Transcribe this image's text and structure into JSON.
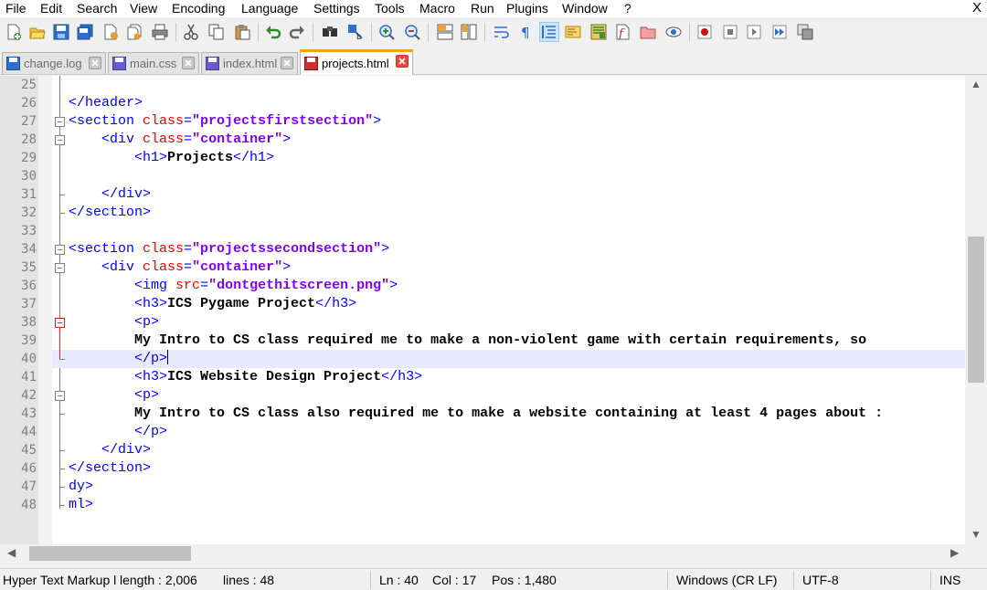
{
  "menu": {
    "items": [
      "File",
      "Edit",
      "Search",
      "View",
      "Encoding",
      "Language",
      "Settings",
      "Tools",
      "Macro",
      "Run",
      "Plugins",
      "Window",
      "?"
    ],
    "close": "X"
  },
  "toolbar": {
    "icons": [
      "new-file-icon",
      "open-file-icon",
      "save-icon",
      "save-all-icon",
      "close-icon",
      "close-all-icon",
      "print-icon",
      "cut-icon",
      "copy-icon",
      "paste-icon",
      "undo-icon",
      "redo-icon",
      "find-icon",
      "replace-icon",
      "zoom-in-icon",
      "zoom-out-icon",
      "sync-vertical-icon",
      "sync-horizontal-icon",
      "word-wrap-icon",
      "show-all-chars-icon",
      "indent-guide-icon",
      "udl-icon",
      "doc-map-icon",
      "function-list-icon",
      "folder-as-workspace-icon",
      "monitoring-icon",
      "record-macro-icon",
      "stop-macro-icon",
      "play-macro-icon",
      "run-macro-multiple-icon",
      "save-macro-icon"
    ]
  },
  "tabs": [
    {
      "label": "change.log",
      "active": false
    },
    {
      "label": "main.css",
      "active": false
    },
    {
      "label": "index.html",
      "active": false
    },
    {
      "label": "projects.html",
      "active": true
    }
  ],
  "editor": {
    "current_line": 40,
    "lines": [
      {
        "n": "25",
        "indent": 0,
        "tokens": []
      },
      {
        "n": "26",
        "indent": 0,
        "tokens": [
          {
            "t": "tag",
            "v": "</header>"
          }
        ]
      },
      {
        "n": "27",
        "indent": 0,
        "tokens": [
          {
            "t": "tag",
            "v": "<section "
          },
          {
            "t": "attr",
            "v": "class"
          },
          {
            "t": "tag",
            "v": "="
          },
          {
            "t": "str",
            "v": "\"projectsfirstsection\""
          },
          {
            "t": "tag",
            "v": ">"
          }
        ]
      },
      {
        "n": "28",
        "indent": 4,
        "tokens": [
          {
            "t": "tag",
            "v": "<div "
          },
          {
            "t": "attr",
            "v": "class"
          },
          {
            "t": "tag",
            "v": "="
          },
          {
            "t": "str",
            "v": "\"container\""
          },
          {
            "t": "tag",
            "v": ">"
          }
        ]
      },
      {
        "n": "29",
        "indent": 8,
        "tokens": [
          {
            "t": "tag",
            "v": "<h1>"
          },
          {
            "t": "txt",
            "v": "Projects"
          },
          {
            "t": "tag",
            "v": "</h1>"
          }
        ]
      },
      {
        "n": "30",
        "indent": 0,
        "tokens": []
      },
      {
        "n": "31",
        "indent": 4,
        "tokens": [
          {
            "t": "tag",
            "v": "</div>"
          }
        ]
      },
      {
        "n": "32",
        "indent": 0,
        "tokens": [
          {
            "t": "tag",
            "v": "</section>"
          }
        ]
      },
      {
        "n": "33",
        "indent": 0,
        "tokens": []
      },
      {
        "n": "34",
        "indent": 0,
        "tokens": [
          {
            "t": "tag",
            "v": "<section "
          },
          {
            "t": "attr",
            "v": "class"
          },
          {
            "t": "tag",
            "v": "="
          },
          {
            "t": "str",
            "v": "\"projectssecondsection\""
          },
          {
            "t": "tag",
            "v": ">"
          }
        ]
      },
      {
        "n": "35",
        "indent": 4,
        "tokens": [
          {
            "t": "tag",
            "v": "<div "
          },
          {
            "t": "attr",
            "v": "class"
          },
          {
            "t": "tag",
            "v": "="
          },
          {
            "t": "str",
            "v": "\"container\""
          },
          {
            "t": "tag",
            "v": ">"
          }
        ]
      },
      {
        "n": "36",
        "indent": 8,
        "tokens": [
          {
            "t": "tag",
            "v": "<img "
          },
          {
            "t": "attr",
            "v": "src"
          },
          {
            "t": "tag",
            "v": "="
          },
          {
            "t": "str",
            "v": "\"dontgethitscreen.png\""
          },
          {
            "t": "tag",
            "v": ">"
          }
        ]
      },
      {
        "n": "37",
        "indent": 8,
        "tokens": [
          {
            "t": "tag",
            "v": "<h3>"
          },
          {
            "t": "txt",
            "v": "ICS Pygame Project"
          },
          {
            "t": "tag",
            "v": "</h3>"
          }
        ]
      },
      {
        "n": "38",
        "indent": 8,
        "tokens": [
          {
            "t": "tag",
            "v": "<p>"
          }
        ]
      },
      {
        "n": "39",
        "indent": 8,
        "tokens": [
          {
            "t": "txt",
            "v": "My Intro to CS class required me to make a non-violent game with certain requirements, so"
          }
        ]
      },
      {
        "n": "40",
        "indent": 8,
        "tokens": [
          {
            "t": "tag",
            "v": "</p>"
          }
        ]
      },
      {
        "n": "41",
        "indent": 8,
        "tokens": [
          {
            "t": "tag",
            "v": "<h3>"
          },
          {
            "t": "txt",
            "v": "ICS Website Design Project"
          },
          {
            "t": "tag",
            "v": "</h3>"
          }
        ]
      },
      {
        "n": "42",
        "indent": 8,
        "tokens": [
          {
            "t": "tag",
            "v": "<p>"
          }
        ]
      },
      {
        "n": "43",
        "indent": 8,
        "tokens": [
          {
            "t": "txt",
            "v": "My Intro to CS class also required me to make a website containing at least 4 pages about :"
          }
        ]
      },
      {
        "n": "44",
        "indent": 8,
        "tokens": [
          {
            "t": "tag",
            "v": "</p>"
          }
        ]
      },
      {
        "n": "45",
        "indent": 4,
        "tokens": [
          {
            "t": "tag",
            "v": "</div>"
          }
        ]
      },
      {
        "n": "46",
        "indent": 0,
        "tokens": [
          {
            "t": "tag",
            "v": "</section>"
          }
        ]
      },
      {
        "n": "47",
        "indent": 0,
        "tokens": [
          {
            "t": "tag",
            "v": "dy>"
          }
        ]
      },
      {
        "n": "48",
        "indent": 0,
        "tokens": [
          {
            "t": "tag",
            "v": "ml>"
          }
        ]
      }
    ]
  },
  "status": {
    "language": "Hyper Text Markup l",
    "length": "length : 2,006",
    "lines": "lines : 48",
    "ln": "Ln : 40",
    "col": "Col : 17",
    "pos": "Pos : 1,480",
    "eol": "Windows (CR LF)",
    "encoding": "UTF-8",
    "mode": "INS"
  },
  "colors": {
    "tag": "#0000ff",
    "attr": "#ff0000",
    "string": "#8000ff",
    "current_line": "#e8e8ff",
    "active_tab_accent": "#f59e1c"
  }
}
